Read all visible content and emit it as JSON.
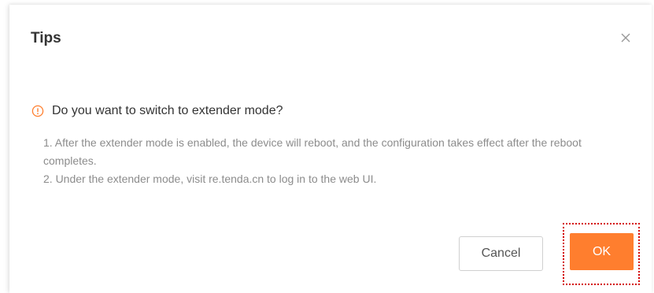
{
  "dialog": {
    "title": "Tips",
    "close_icon": "close-icon",
    "warning_icon": "exclamation-circle-icon",
    "question": "Do you want to switch to extender mode?",
    "notes": [
      "1. After the extender mode is enabled, the device will reboot, and the configuration takes effect after the reboot completes.",
      "2. Under the extender mode, visit re.tenda.cn to log in to the web UI."
    ],
    "buttons": {
      "cancel_label": "Cancel",
      "ok_label": "OK"
    },
    "colors": {
      "accent": "#ff7e2e",
      "highlight_frame": "#d40000"
    }
  }
}
